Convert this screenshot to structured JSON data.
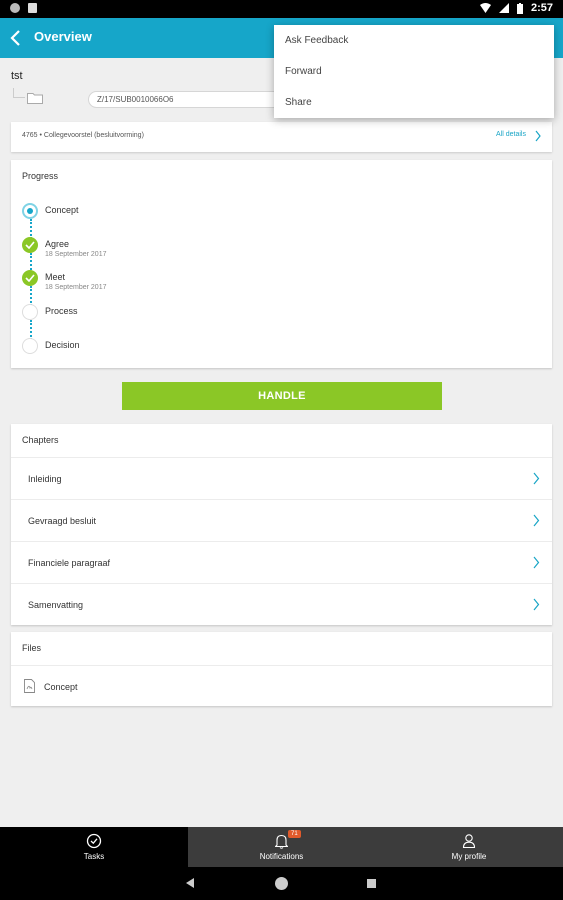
{
  "status_bar": {
    "time": "2:57"
  },
  "app_bar": {
    "title": "Overview"
  },
  "task": {
    "title": "tst",
    "document_number": "Z/17/SUB0010066O6",
    "info_text": "4765 • Collegevoorstel (besluitvorming)",
    "all_details_label": "All details"
  },
  "progress": {
    "title": "Progress",
    "steps": [
      {
        "label": "Concept",
        "date": "",
        "state": "current"
      },
      {
        "label": "Agree",
        "date": "18 September 2017",
        "state": "done"
      },
      {
        "label": "Meet",
        "date": "18 September 2017",
        "state": "done"
      },
      {
        "label": "Process",
        "date": "",
        "state": "pending"
      },
      {
        "label": "Decision",
        "date": "",
        "state": "pending"
      }
    ]
  },
  "handle_button": {
    "label": "HANDLE"
  },
  "chapters": {
    "title": "Chapters",
    "items": [
      {
        "label": "Inleiding"
      },
      {
        "label": "Gevraagd besluit"
      },
      {
        "label": "Financiele paragraaf"
      },
      {
        "label": "Samenvatting"
      }
    ]
  },
  "files": {
    "title": "Files",
    "items": [
      {
        "label": "Concept",
        "icon": "pdf-icon"
      }
    ]
  },
  "popup_menu": {
    "items": [
      {
        "label": "Ask Feedback"
      },
      {
        "label": "Forward"
      },
      {
        "label": "Share"
      }
    ]
  },
  "tab_bar": {
    "tabs": [
      {
        "label": "Tasks",
        "icon": "check-circle-icon",
        "active": true
      },
      {
        "label": "Notifications",
        "icon": "bell-icon",
        "badge": "71",
        "active": false
      },
      {
        "label": "My profile",
        "icon": "person-icon",
        "active": false
      }
    ]
  },
  "colors": {
    "primary": "#16a6c9",
    "success": "#8bc726",
    "badge": "#e05a2b"
  }
}
